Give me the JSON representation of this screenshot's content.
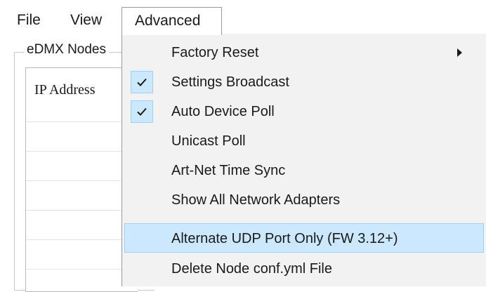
{
  "menubar": {
    "items": [
      {
        "label": "File"
      },
      {
        "label": "View"
      },
      {
        "label": "Advanced"
      }
    ]
  },
  "group": {
    "title": "eDMX Nodes"
  },
  "list": {
    "column_header": "IP Address"
  },
  "advanced_menu": {
    "items": [
      {
        "label": "Factory Reset",
        "has_submenu": true
      },
      {
        "label": "Settings Broadcast",
        "checked": true
      },
      {
        "label": "Auto Device Poll",
        "checked": true
      },
      {
        "label": "Unicast Poll",
        "checked": false
      },
      {
        "label": "Art-Net Time Sync",
        "checked": false
      },
      {
        "label": "Show All Network Adapters",
        "checked": false
      },
      {
        "label": "Alternate UDP Port Only (FW 3.12+)",
        "checked": false,
        "highlighted": true
      },
      {
        "label": "Delete Node conf.yml File",
        "checked": false
      }
    ]
  },
  "icons": {
    "check": "checkmark-icon",
    "submenu": "chevron-right-icon"
  },
  "colors": {
    "highlight_fill": "#cce8ff",
    "highlight_border": "#99d1ff",
    "menu_background": "#f2f2f2"
  }
}
